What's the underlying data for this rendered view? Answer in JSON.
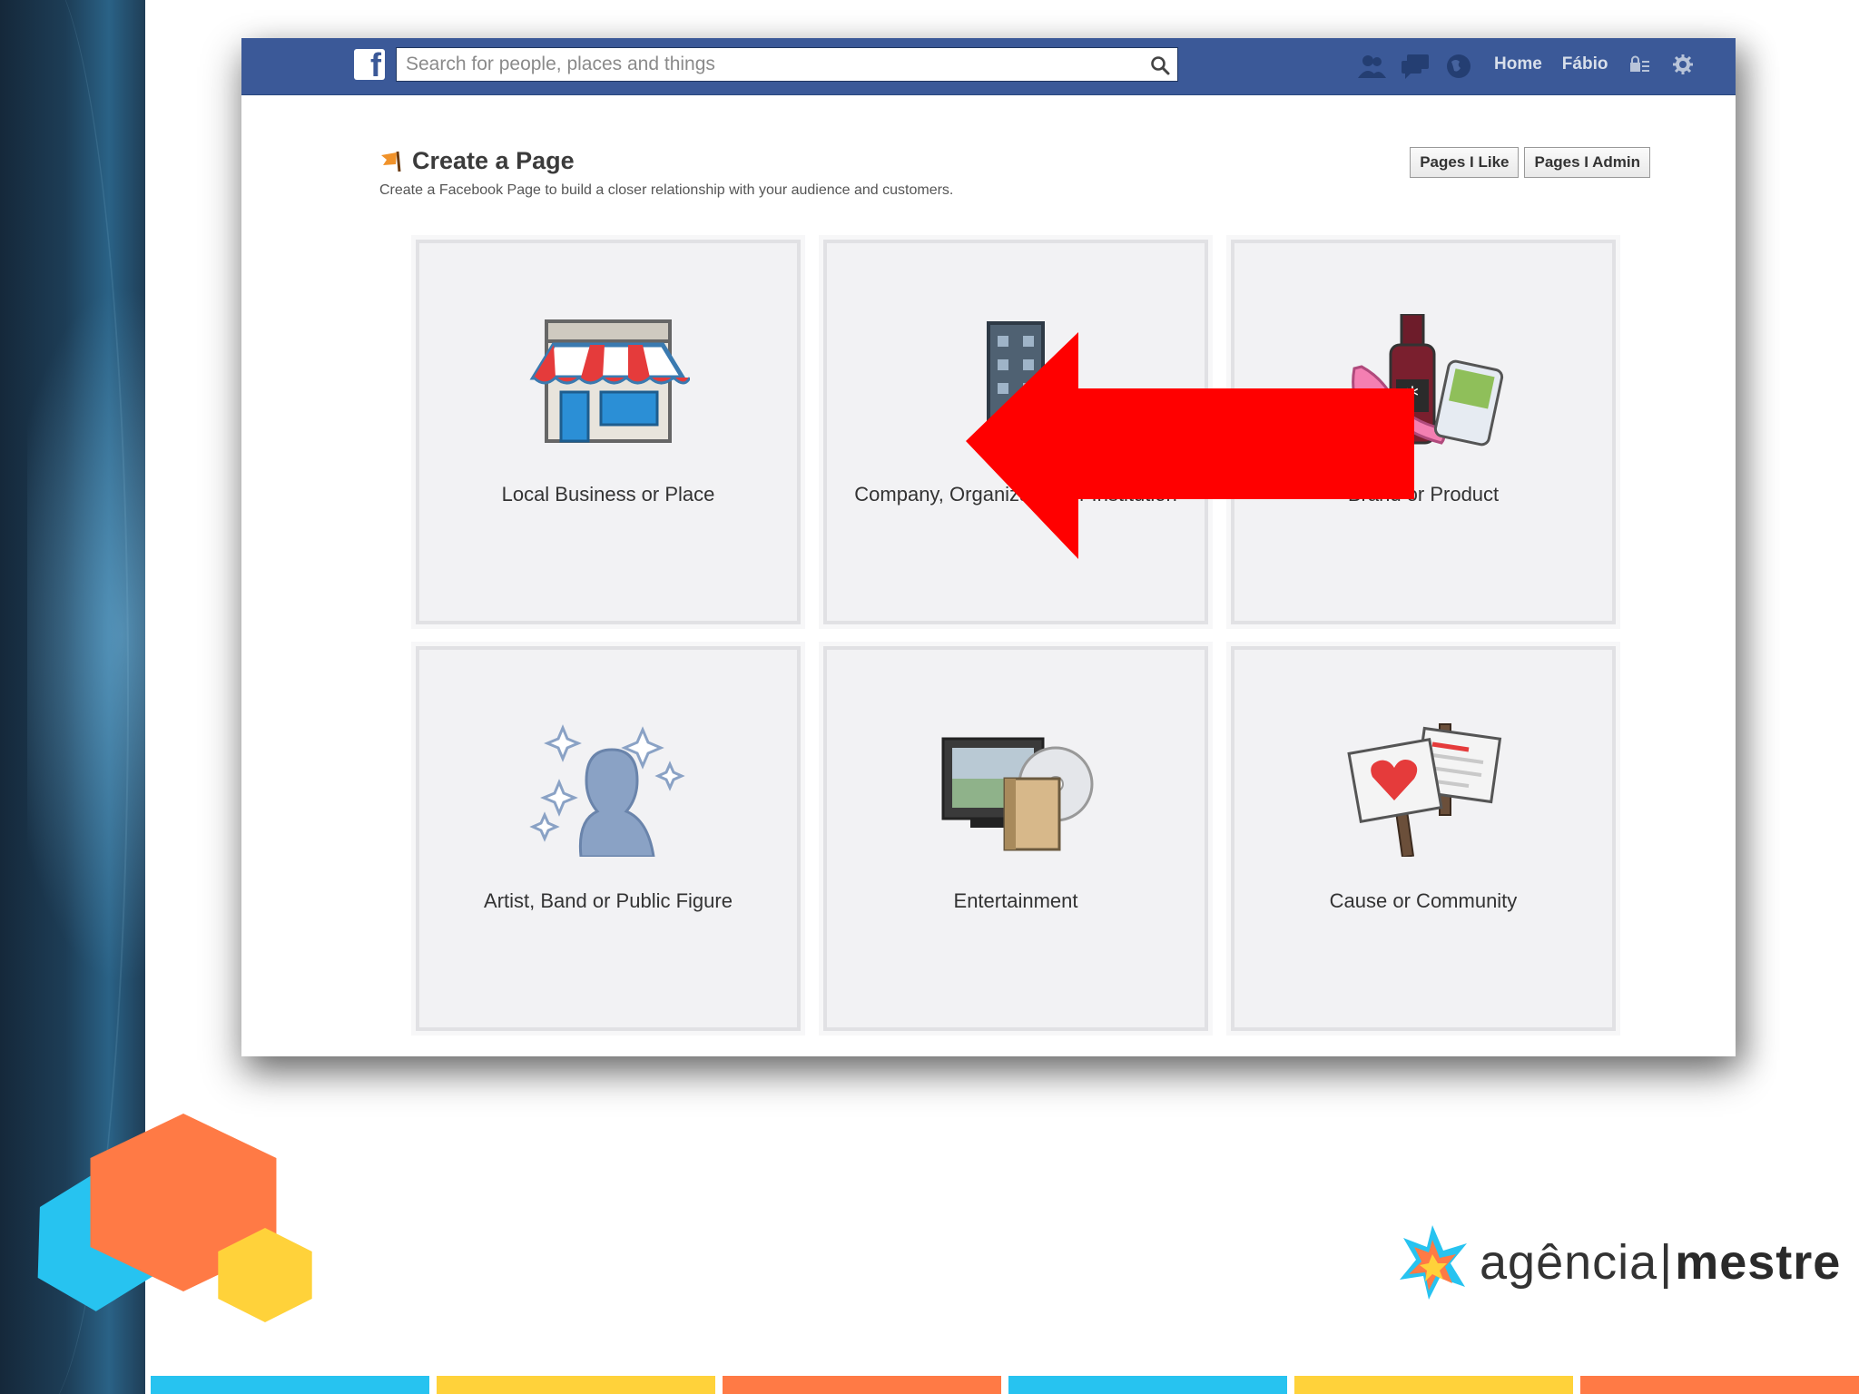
{
  "colors": {
    "fb_blue": "#3b5998",
    "arrow_red": "#ff0000",
    "bar_colors": [
      "#27c3f0",
      "#ffd23a",
      "#ff7a45",
      "#27c3f0",
      "#ffd23a",
      "#ff7a45"
    ]
  },
  "topbar": {
    "logo_icon": "facebook-f-logo-icon",
    "search": {
      "placeholder": "Search for people, places and things",
      "value": ""
    },
    "icons": [
      "friend-requests-icon",
      "messages-icon",
      "notifications-globe-icon"
    ],
    "home_label": "Home",
    "user_label": "Fábio",
    "settings_icons": [
      "privacy-shortcuts-icon",
      "gear-icon"
    ]
  },
  "page": {
    "title": "Create a Page",
    "title_icon": "flag-icon",
    "subtitle": "Create a Facebook Page to build a closer relationship with your audience and customers.",
    "buttons": {
      "pages_i_like": "Pages I Like",
      "pages_i_admin": "Pages I Admin"
    }
  },
  "categories": [
    {
      "label": "Local Business or Place",
      "icon": "storefront-icon"
    },
    {
      "label": "Company, Organization or Institution",
      "icon": "office-building-icon"
    },
    {
      "label": "Brand or Product",
      "icon": "products-icon"
    },
    {
      "label": "Artist, Band or Public Figure",
      "icon": "public-figure-silhouette-icon"
    },
    {
      "label": "Entertainment",
      "icon": "tv-and-disc-icon"
    },
    {
      "label": "Cause or Community",
      "icon": "protest-signs-icon"
    }
  ],
  "annotation": {
    "icon": "red-arrow-pointer-icon"
  },
  "brand": {
    "name_light": "agência",
    "separator": "|",
    "name_bold": "mestre",
    "icon": "agencia-mestre-star-logo-icon"
  }
}
